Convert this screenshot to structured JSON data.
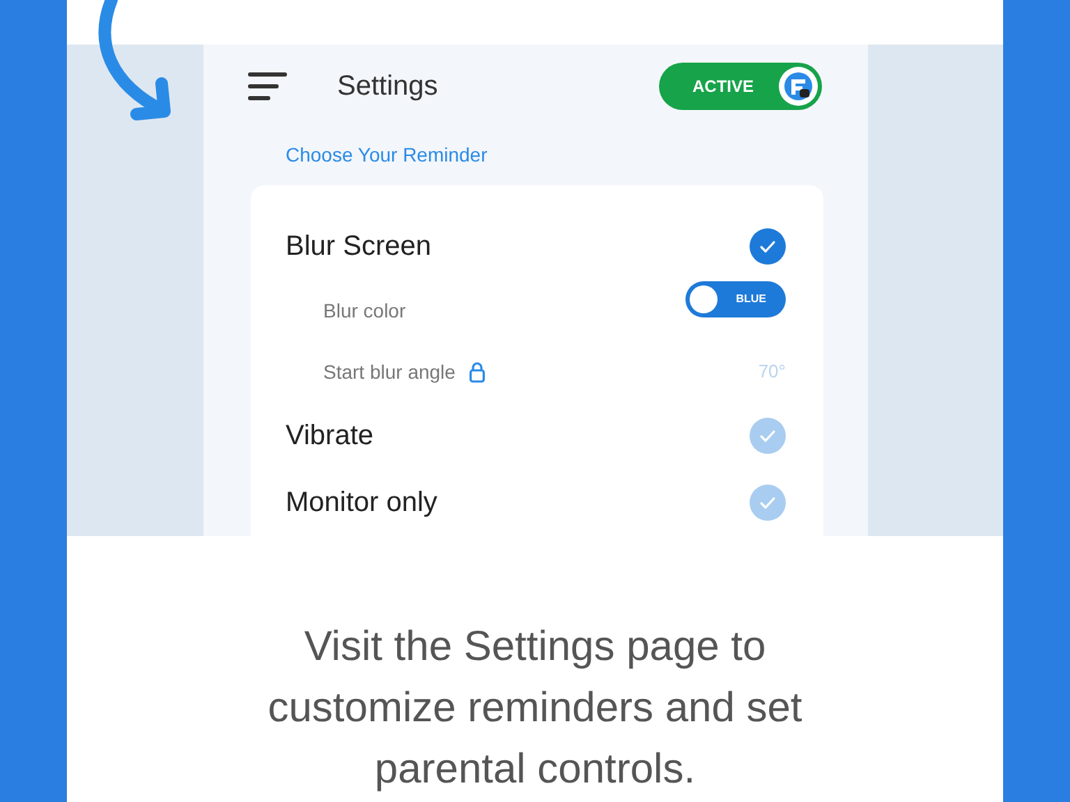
{
  "app_bar": {
    "title": "Settings",
    "status": {
      "label": "ACTIVE",
      "on": true
    }
  },
  "section_title": "Choose Your Reminder",
  "options": [
    {
      "kind": "check",
      "label": "Blur Screen",
      "checked": true
    },
    {
      "kind": "toggle",
      "label": "Blur color",
      "value": "BLUE",
      "on": false
    },
    {
      "kind": "locked",
      "label": "Start blur angle",
      "value": "70°"
    },
    {
      "kind": "check",
      "label": "Vibrate",
      "checked": false
    },
    {
      "kind": "check",
      "label": "Monitor only",
      "checked": false
    }
  ],
  "caption": "Visit the Settings page to customize reminders and set parental controls."
}
